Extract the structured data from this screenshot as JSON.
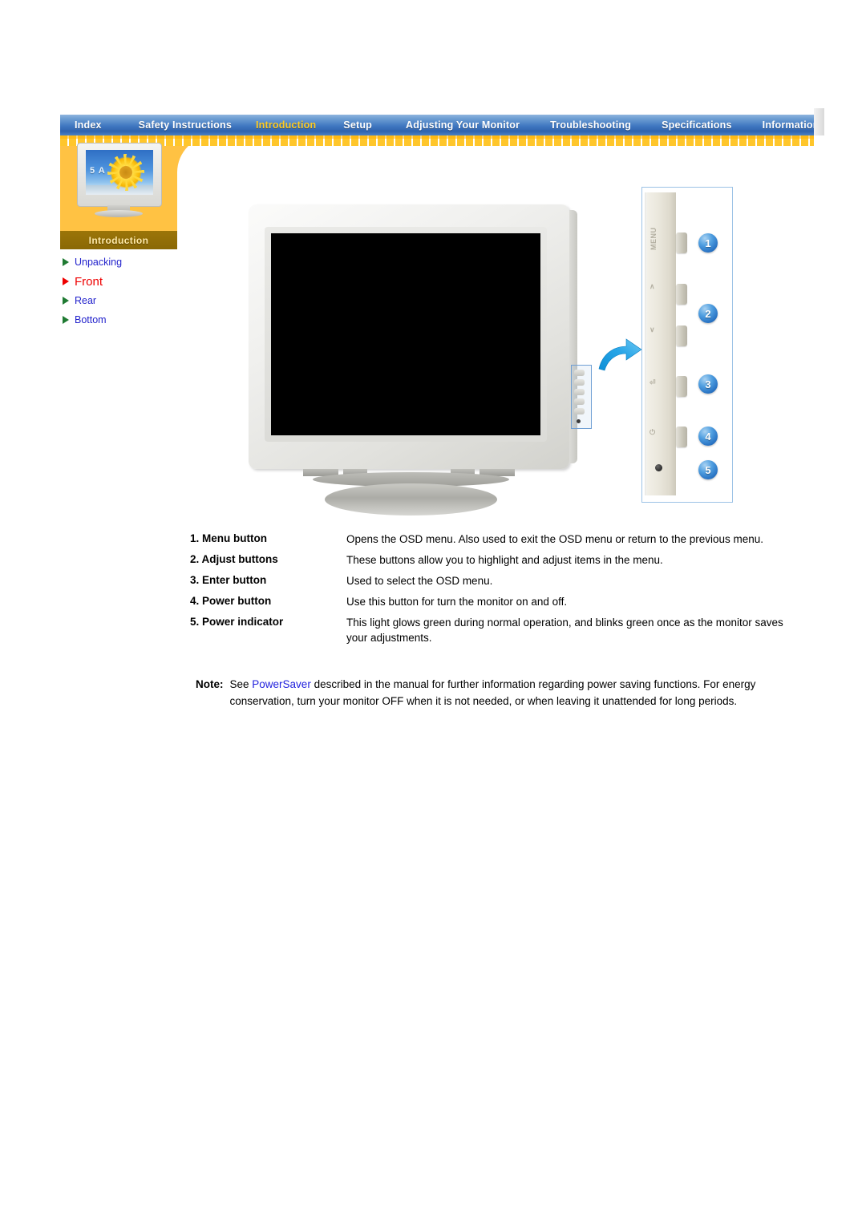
{
  "nav": {
    "items": [
      {
        "label": "Index",
        "active": false
      },
      {
        "label": "Safety Instructions",
        "active": false
      },
      {
        "label": "Introduction",
        "active": true
      },
      {
        "label": "Setup",
        "active": false
      },
      {
        "label": "Adjusting Your Monitor",
        "active": false
      },
      {
        "label": "Troubleshooting",
        "active": false
      },
      {
        "label": "Specifications",
        "active": false
      },
      {
        "label": "Information",
        "active": false
      }
    ]
  },
  "sidebar": {
    "thumb_caption": "Introduction",
    "thumb_screen_text": "5 A",
    "links": [
      {
        "label": "Unpacking",
        "current": false
      },
      {
        "label": "Front",
        "current": true
      },
      {
        "label": "Rear",
        "current": false
      },
      {
        "label": "Bottom",
        "current": false
      }
    ]
  },
  "illustration": {
    "osd_marks": [
      "MENU",
      "∧",
      "∨",
      "⏎",
      "⏻"
    ],
    "callouts": [
      "1",
      "2",
      "3",
      "4",
      "5"
    ]
  },
  "descriptions": [
    {
      "term": "1. Menu button",
      "definition": "Opens the OSD menu. Also used to exit the OSD menu or return to the previous menu."
    },
    {
      "term": "2. Adjust buttons",
      "definition": "These buttons allow you to highlight and adjust items in the menu."
    },
    {
      "term": "3. Enter button",
      "definition": "Used to select the OSD menu."
    },
    {
      "term": "4. Power button",
      "definition": "Use this button for turn the monitor on and off."
    },
    {
      "term": "5. Power indicator",
      "definition": "This light glows green during normal operation, and blinks green once as the monitor saves your adjustments."
    }
  ],
  "note": {
    "label": "Note:",
    "text_before": "See ",
    "link": "PowerSaver",
    "text_after": " described in the manual for further information regarding power saving functions. For energy conservation, turn your monitor OFF when it is not needed, or when leaving it unattended for long periods."
  },
  "colors": {
    "nav_active": "#ffcc22",
    "nav_blue": "#3f77c0",
    "band_yellow": "#ffc62b",
    "link_blue": "#2222cc",
    "current_red": "#ee0000",
    "callout_blue": "#2a74c4"
  }
}
